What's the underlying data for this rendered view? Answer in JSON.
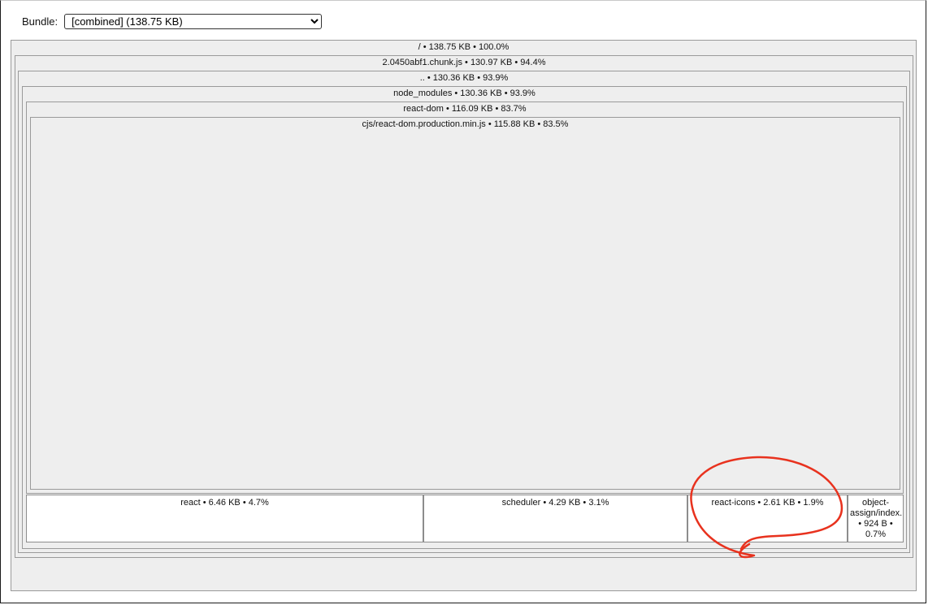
{
  "toolbar": {
    "bundle_label": "Bundle:",
    "bundle_selected": "[combined] (138.75 KB)"
  },
  "treemap": {
    "root": "/ • 138.75 KB • 100.0%",
    "chunk": "2.0450abf1.chunk.js • 130.97 KB • 94.4%",
    "parent": ".. • 130.36 KB • 93.9%",
    "node_modules": "node_modules • 130.36 KB • 93.9%",
    "react_dom": "react-dom • 116.09 KB • 83.7%",
    "react_dom_min": "cjs/react-dom.production.min.js • 115.88 KB • 83.5%",
    "react": "react • 6.46 KB • 4.7%",
    "scheduler": "scheduler • 4.29 KB • 3.1%",
    "react_icons": "react-icons • 2.61 KB • 1.9%",
    "object_assign": "object-assign/index. • 924 B • 0.7%"
  },
  "colors": {
    "annotation": "#e8321e",
    "node_fill": "#eeeeee",
    "leaf_fill": "#ffffff"
  }
}
